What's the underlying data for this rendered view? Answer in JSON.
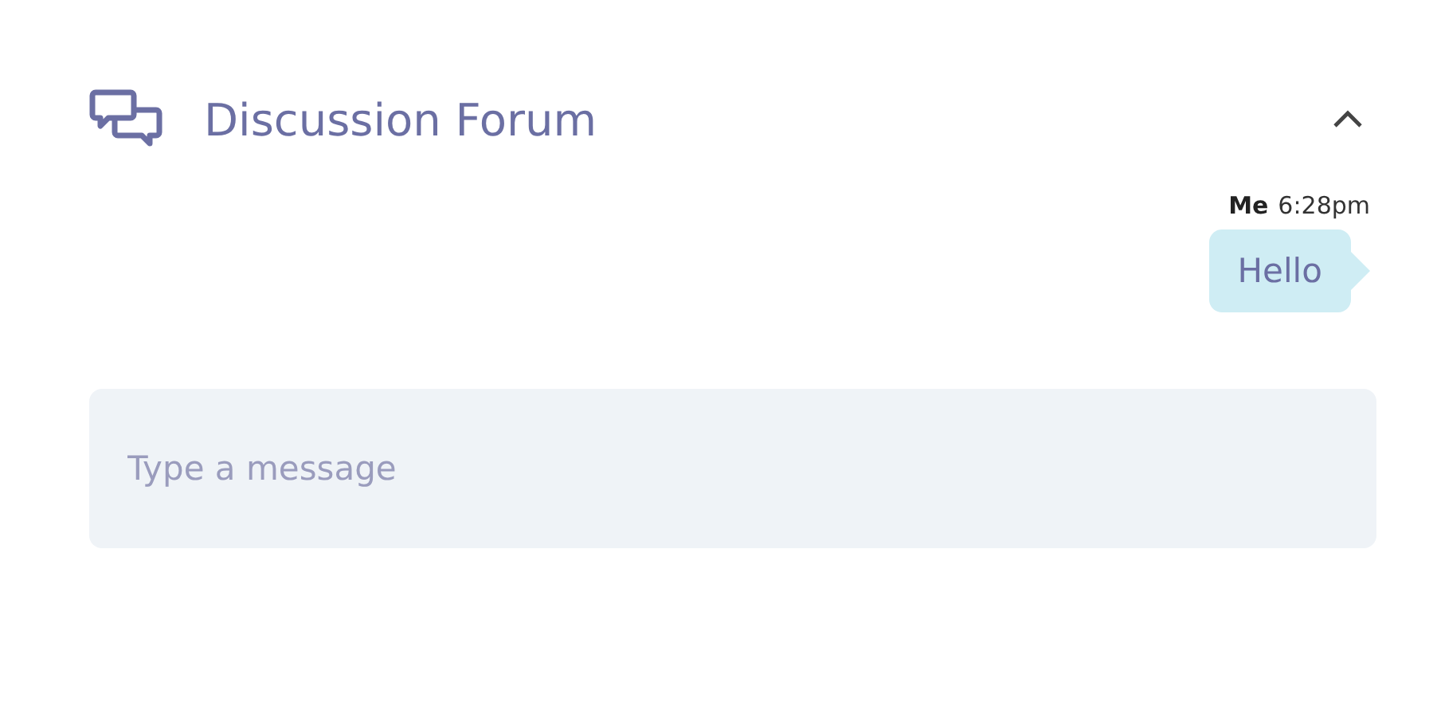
{
  "panel": {
    "title": "Discussion Forum",
    "expanded": true
  },
  "messages": [
    {
      "author": "Me",
      "time": "6:28pm",
      "text": "Hello",
      "mine": true
    }
  ],
  "composer": {
    "placeholder": "Type a message"
  }
}
